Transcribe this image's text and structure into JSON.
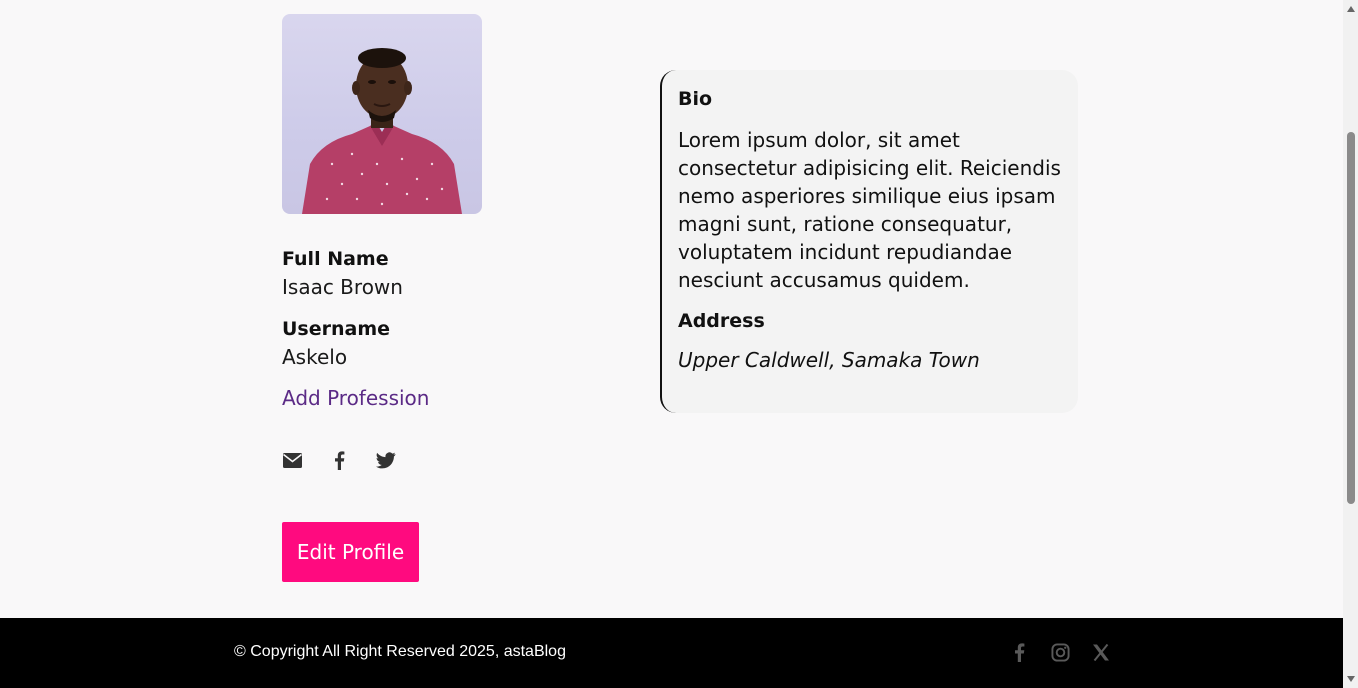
{
  "profile": {
    "avatar_alt": "Profile photo",
    "full_name_label": "Full Name",
    "full_name": "Isaac Brown",
    "username_label": "Username",
    "username": "Askelo",
    "add_profession": "Add Profession",
    "edit_button": "Edit Profile",
    "social_icons": [
      "envelope-icon",
      "facebook-icon",
      "twitter-icon"
    ]
  },
  "card": {
    "bio_heading": "Bio",
    "bio_text": "Lorem ipsum dolor, sit amet consectetur adipisicing elit. Reiciendis nemo asperiores similique eius ipsam magni sunt, ratione consequatur, voluptatem incidunt repudiandae nesciunt accusamus quidem.",
    "address_heading": "Address",
    "address_text": "Upper Caldwell, Samaka Town"
  },
  "footer": {
    "copyright": "© Copyright All Right Reserved 2025, astaBlog",
    "social_icons": [
      "facebook-icon",
      "instagram-icon",
      "x-icon"
    ]
  },
  "colors": {
    "accent": "#ff0a7f",
    "link": "#5b2a86",
    "footer_bg": "#000000",
    "page_bg": "#f9f8f9"
  }
}
